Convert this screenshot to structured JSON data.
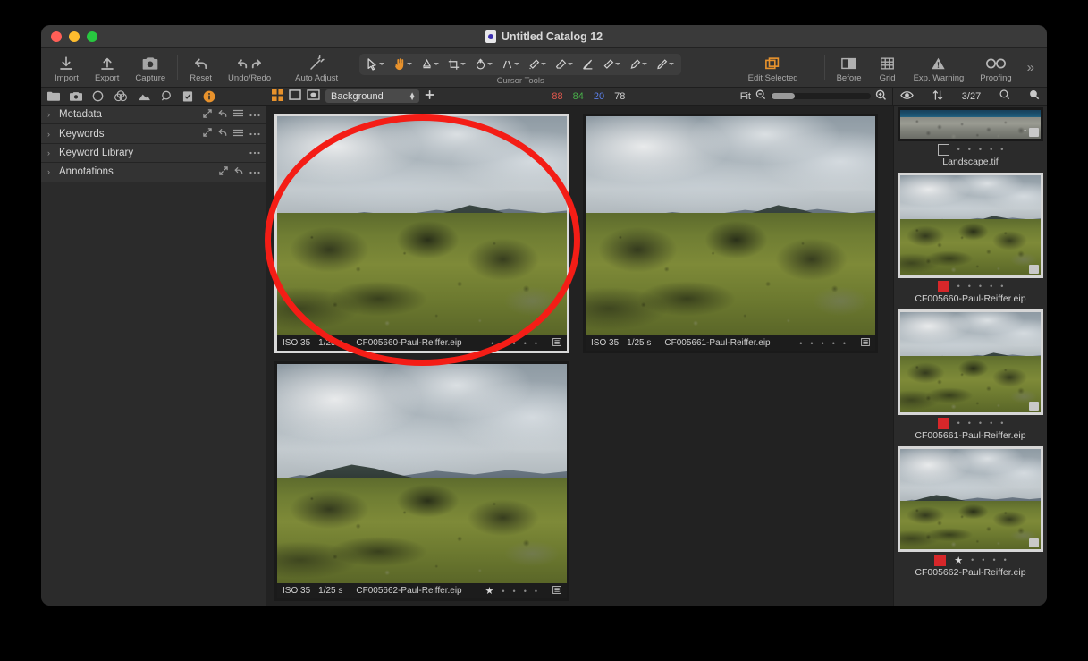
{
  "window": {
    "title": "Untitled Catalog 12",
    "doc_icon": "catalog-document-icon",
    "traffic_lights": [
      "close",
      "minimize",
      "zoom"
    ]
  },
  "toolbar": {
    "groups": [
      {
        "name": "file",
        "buttons": [
          {
            "label": "Import",
            "icon": "import-arrow-down-icon"
          },
          {
            "label": "Export",
            "icon": "export-arrow-up-icon"
          },
          {
            "label": "Capture",
            "icon": "camera-icon"
          }
        ]
      },
      {
        "name": "history",
        "buttons": [
          {
            "label": "Reset",
            "icon": "reset-arrow-icon"
          },
          {
            "label": "Undo/Redo",
            "icon": "undo-redo-arrows-icon"
          }
        ]
      },
      {
        "name": "adjust",
        "buttons": [
          {
            "label": "Auto Adjust",
            "icon": "magic-wand-icon"
          }
        ]
      }
    ],
    "cursor_tools": {
      "group_label": "Cursor Tools",
      "items": [
        {
          "icon": "pointer-select-icon",
          "active": false
        },
        {
          "icon": "pan-hand-icon",
          "active": true
        },
        {
          "icon": "white-balance-picker-icon",
          "active": false
        },
        {
          "icon": "crop-icon",
          "active": false
        },
        {
          "icon": "rotate-icon",
          "active": false
        },
        {
          "icon": "keystone-icon",
          "active": false
        },
        {
          "icon": "spot-removal-icon",
          "active": false
        },
        {
          "icon": "dust-eraser-icon",
          "active": false
        },
        {
          "icon": "draw-mask-icon",
          "active": false
        },
        {
          "icon": "gradient-mask-icon",
          "active": false
        },
        {
          "icon": "heal-brush-icon",
          "active": false
        },
        {
          "icon": "clone-brush-icon",
          "active": false
        }
      ]
    },
    "edit_selected": {
      "label": "Edit Selected",
      "icon": "stacked-layers-icon",
      "active": true
    },
    "view_buttons": [
      {
        "label": "Before",
        "icon": "before-after-split-icon"
      },
      {
        "label": "Grid",
        "icon": "grid-overlay-icon"
      },
      {
        "label": "Exp. Warning",
        "icon": "exposure-warning-triangle-icon"
      },
      {
        "label": "Proofing",
        "icon": "proofing-glasses-icon"
      }
    ],
    "overflow": {
      "icon": "chevron-double-right-icon",
      "label": "»"
    }
  },
  "subbar": {
    "left_tabs": [
      {
        "icon": "library-folder-icon",
        "active": false
      },
      {
        "icon": "capture-camera-icon",
        "active": false
      },
      {
        "icon": "lens-circle-icon",
        "active": false
      },
      {
        "icon": "color-wheels-icon",
        "active": false
      },
      {
        "icon": "exposure-icon",
        "active": false
      },
      {
        "icon": "details-loupe-icon",
        "active": false
      },
      {
        "icon": "adjustments-clipboard-icon",
        "active": false
      },
      {
        "icon": "metadata-info-icon",
        "active": true
      }
    ],
    "view_modes": [
      {
        "icon": "grid-view-icon",
        "active": true
      },
      {
        "icon": "single-view-icon",
        "active": false
      },
      {
        "icon": "viewer-toggle-icon",
        "active": false
      }
    ],
    "background_select": {
      "value": "Background",
      "stepper_icon": "up-down-stepper-icon"
    },
    "add_button": {
      "icon": "plus-add-icon"
    },
    "readout": {
      "r": "88",
      "g": "84",
      "b": "20",
      "k": "78",
      "r_color": "#e2584d",
      "g_color": "#49b04a",
      "b_color": "#5b7fe8",
      "k_color": "#cfcfcf"
    },
    "zoom": {
      "label": "Fit",
      "zoom_out_icon": "zoom-out-icon",
      "zoom_in_icon": "zoom-in-icon"
    },
    "filmstrip_header": {
      "visibility_icon": "eye-icon",
      "sort_icon": "sort-arrows-icon",
      "count": "3/27",
      "search_icon": "search-icon",
      "filter_icon": "filter-loupe-icon"
    }
  },
  "left_panel": {
    "accordions": [
      {
        "title": "Metadata",
        "arrow": "›",
        "icons": [
          "expand-icon",
          "reset-icon",
          "menu-icon",
          "more-icon"
        ]
      },
      {
        "title": "Keywords",
        "arrow": "›",
        "icons": [
          "expand-icon",
          "reset-icon",
          "menu-icon",
          "more-icon"
        ]
      },
      {
        "title": "Keyword Library",
        "arrow": "›",
        "icons": [
          "more-icon"
        ]
      },
      {
        "title": "Annotations",
        "arrow": "›",
        "icons": [
          "expand-icon",
          "reset-icon",
          "more-icon"
        ]
      }
    ]
  },
  "browser": {
    "cells": [
      {
        "name": "CF005660-Paul-Reiffer.eip",
        "iso": "ISO 35",
        "shutter": "1/25 s",
        "rating": 0,
        "selected": true,
        "scene": "moss",
        "badge_icon": "variant-badge-icon"
      },
      {
        "name": "CF005661-Paul-Reiffer.eip",
        "iso": "ISO 35",
        "shutter": "1/25 s",
        "rating": 0,
        "selected": false,
        "scene": "moss",
        "badge_icon": "variant-badge-icon"
      },
      {
        "name": "CF005662-Paul-Reiffer.eip",
        "iso": "ISO 35",
        "shutter": "1/25 s",
        "rating": 1,
        "selected": false,
        "scene": "valley",
        "badge_icon": "variant-badge-icon"
      }
    ],
    "annotation": {
      "shape": "ellipse",
      "color": "#f41d16"
    }
  },
  "filmstrip": {
    "items": [
      {
        "name": "Landscape.tif",
        "tag": "none",
        "rating": 0,
        "selected": false,
        "scene": "sea",
        "partial_top": true
      },
      {
        "name": "CF005660-Paul-Reiffer.eip",
        "tag": "red",
        "rating": 0,
        "selected": true,
        "scene": "moss"
      },
      {
        "name": "CF005661-Paul-Reiffer.eip",
        "tag": "red",
        "rating": 0,
        "selected": true,
        "scene": "moss"
      },
      {
        "name": "CF005662-Paul-Reiffer.eip",
        "tag": "red",
        "rating": 1,
        "selected": true,
        "scene": "valley"
      }
    ],
    "tag_red_color": "#d7272a"
  }
}
